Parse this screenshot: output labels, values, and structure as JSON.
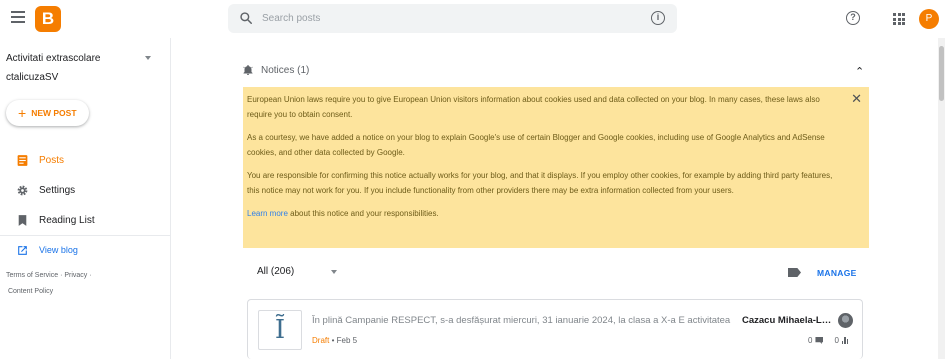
{
  "header": {
    "logo_letter": "B",
    "search_placeholder": "Search posts",
    "info_symbol": "i",
    "help_symbol": "?",
    "avatar_letter": "P",
    "brand_color": "#f57d00"
  },
  "sidebar": {
    "blog_name": "Activitati extrascolare",
    "blog_subtitle": "ctalicuzaSV",
    "new_post_label": "NEW POST",
    "items": [
      {
        "label": "Posts",
        "icon": "posts-icon",
        "active": true
      },
      {
        "label": "Settings",
        "icon": "gear-icon"
      },
      {
        "label": "Reading List",
        "icon": "bookmark-icon"
      },
      {
        "label": "View blog",
        "icon": "open-external-icon"
      }
    ],
    "footer": {
      "terms": "Terms of Service",
      "privacy": "Privacy",
      "content_policy": "Content Policy"
    }
  },
  "notices": {
    "title": "Notices (1)",
    "paragraph1": "European Union laws require you to give European Union visitors information about cookies used and data collected on your blog. In many cases, these laws also require you to obtain consent.",
    "paragraph2": "As a courtesy, we have added a notice on your blog to explain Google's use of certain Blogger and Google cookies, including use of Google Analytics and AdSense cookies, and other data collected by Google.",
    "paragraph3": "You are responsible for confirming this notice actually works for your blog, and that it displays. If you employ other cookies, for example by adding third party features, this notice may not work for you. If you include functionality from other providers there may be extra information collected from your users.",
    "learn_more_link": "Learn more",
    "learn_more_rest": " about this notice and your responsibilities.",
    "background_color": "#fde293"
  },
  "posts_list": {
    "filter_label": "All (206)",
    "manage_label": "MANAGE",
    "posts": [
      {
        "thumbnail_glyph": "Ĩ",
        "title": "În plină Campanie RESPECT, s-a desfășurat miercuri, 31 ianuarie 2024, la clasa a X-a E activitatea",
        "author": "Cazacu Mihaela-Lumini",
        "status": "Draft",
        "date": "• Feb 5",
        "comments": "0",
        "views": "0"
      }
    ]
  }
}
